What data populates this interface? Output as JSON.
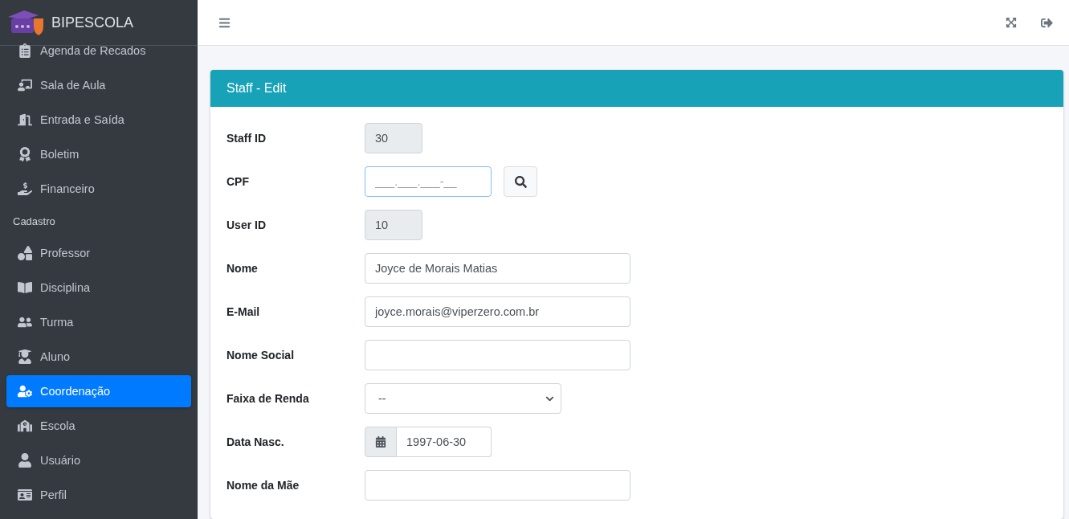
{
  "brand": {
    "name": "BIPESCOLA"
  },
  "sidebar": {
    "items": [
      {
        "kind": "link",
        "label": "Agenda de Recados",
        "selected": false
      },
      {
        "kind": "link",
        "label": "Sala de Aula",
        "selected": false
      },
      {
        "kind": "link",
        "label": "Entrada e Saída",
        "selected": false
      },
      {
        "kind": "link",
        "label": "Boletim",
        "selected": false
      },
      {
        "kind": "link",
        "label": "Financeiro",
        "selected": false
      },
      {
        "kind": "header",
        "label": "Cadastro"
      },
      {
        "kind": "link",
        "label": "Professor",
        "selected": false
      },
      {
        "kind": "link",
        "label": "Disciplina",
        "selected": false
      },
      {
        "kind": "link",
        "label": "Turma",
        "selected": false
      },
      {
        "kind": "link",
        "label": "Aluno",
        "selected": false
      },
      {
        "kind": "link",
        "label": "Coordenação",
        "selected": true
      },
      {
        "kind": "link",
        "label": "Escola",
        "selected": false
      },
      {
        "kind": "link",
        "label": "Usuário",
        "selected": false
      },
      {
        "kind": "link",
        "label": "Perfil",
        "selected": false
      }
    ]
  },
  "card": {
    "title": "Staff - Edit",
    "fields": [
      {
        "kind": "readonly",
        "label": "Staff ID",
        "value": "30"
      },
      {
        "kind": "search",
        "label": "CPF",
        "placeholder": "___.___.___-__"
      },
      {
        "kind": "readonly",
        "label": "User ID",
        "value": "10"
      },
      {
        "kind": "text",
        "label": "Nome",
        "value": "Joyce de Morais Matias"
      },
      {
        "kind": "text",
        "label": "E-Mail",
        "value": "joyce.morais@viperzero.com.br"
      },
      {
        "kind": "text",
        "label": "Nome Social"
      },
      {
        "kind": "select",
        "label": "Faixa de Renda",
        "value": "--"
      },
      {
        "kind": "date",
        "label": "Data Nasc.",
        "value": "1997-06-30"
      },
      {
        "kind": "text",
        "label": "Nome da Mãe"
      }
    ]
  }
}
